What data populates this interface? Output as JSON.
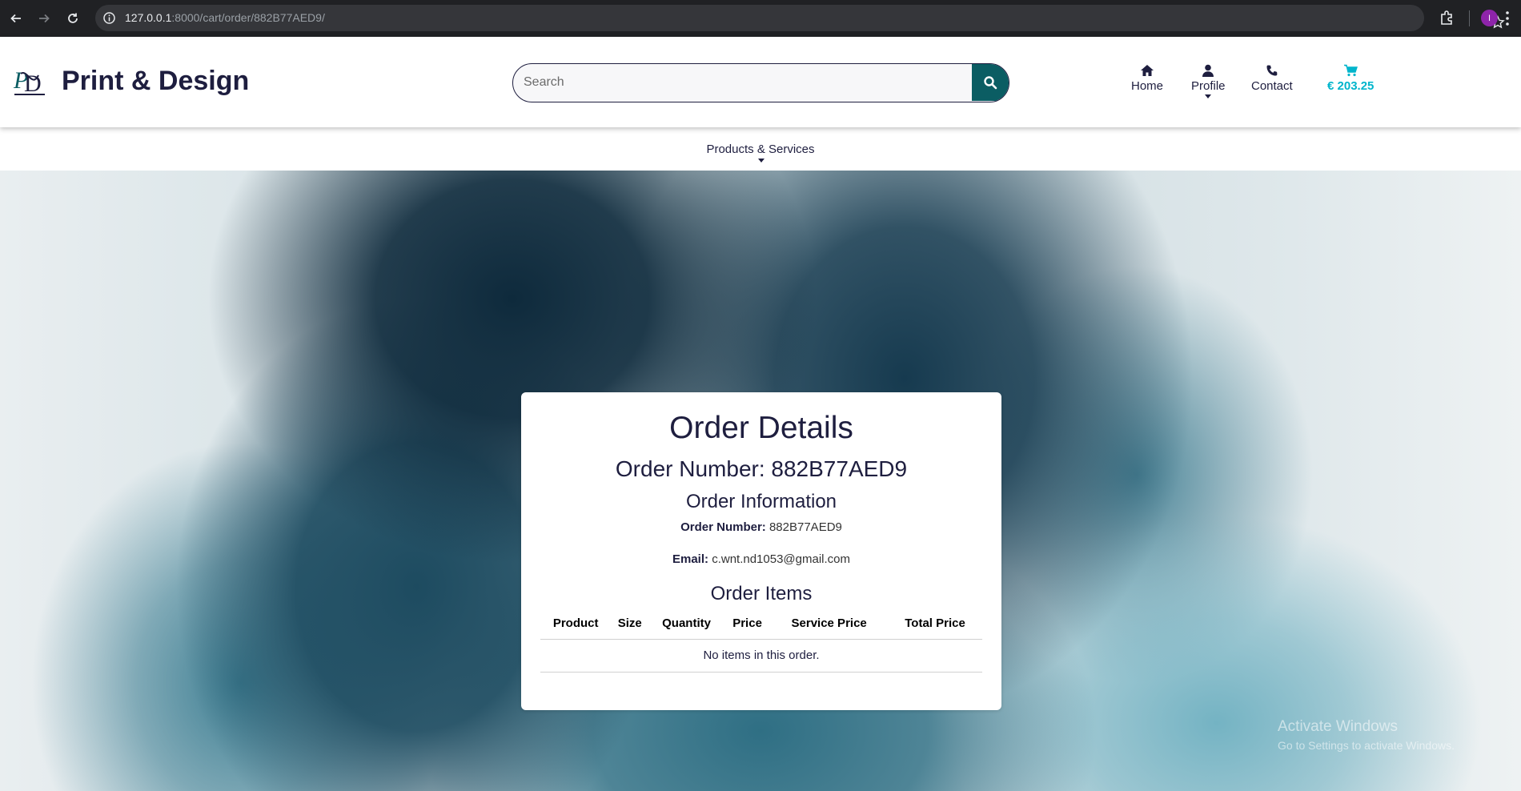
{
  "browser": {
    "url_host": "127.0.0.1",
    "url_rest": ":8000/cart/order/882B77AED9/",
    "profile_initial": "I"
  },
  "header": {
    "site_title": "Print & Design",
    "search_placeholder": "Search",
    "nav": {
      "home": "Home",
      "profile": "Profile",
      "contact": "Contact",
      "cart_total": "€ 203.25"
    }
  },
  "sub_nav": {
    "products_services": "Products & Services"
  },
  "order": {
    "title": "Order Details",
    "order_number_heading": "Order Number: 882B77AED9",
    "info_heading": "Order Information",
    "order_number_label": "Order Number:",
    "order_number_value": "882B77AED9",
    "email_label": "Email:",
    "email_value": "c.wnt.nd1053@gmail.com",
    "items_heading": "Order Items",
    "columns": [
      "Product",
      "Size",
      "Quantity",
      "Price",
      "Service Price",
      "Total Price"
    ],
    "empty_message": "No items in this order."
  },
  "watermark": {
    "title": "Activate Windows",
    "subtitle": "Go to Settings to activate Windows."
  },
  "colors": {
    "brand_dark": "#1e1e3f",
    "search_button": "#0b5d63",
    "cart_accent": "#00b5cc"
  },
  "icons": [
    "back-arrow-icon",
    "forward-arrow-icon",
    "reload-icon",
    "info-icon",
    "star-icon",
    "extensions-icon",
    "search-icon",
    "home-icon",
    "user-icon",
    "phone-icon",
    "cart-icon"
  ]
}
